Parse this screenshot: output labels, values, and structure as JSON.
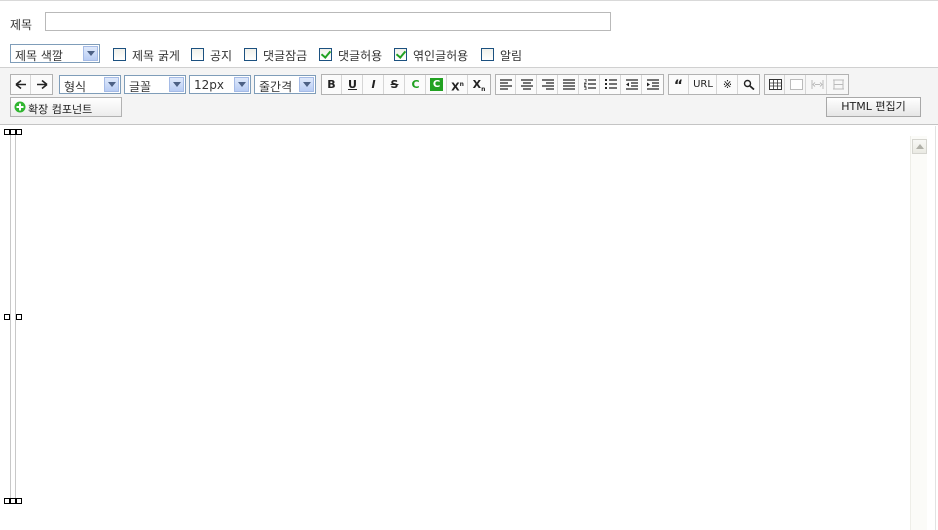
{
  "title_row": {
    "label": "제목",
    "value": ""
  },
  "options": {
    "title_color_select": "제목 색깔",
    "checkboxes": [
      {
        "label": "제목 굵게",
        "checked": false
      },
      {
        "label": "공지",
        "checked": false
      },
      {
        "label": "댓글잠금",
        "checked": false
      },
      {
        "label": "댓글허용",
        "checked": true
      },
      {
        "label": "엮인글허용",
        "checked": true
      },
      {
        "label": "알림",
        "checked": false
      }
    ]
  },
  "toolbar": {
    "format_select": "형식",
    "font_select": "글꼴",
    "size_select": "12px",
    "lineheight_select": "줄간격",
    "text_buttons": {
      "bold": "B",
      "underline": "U",
      "italic": "I",
      "strike": "S",
      "fcolor": "C",
      "bgcolor": "C",
      "sup": "X",
      "sub": "X",
      "quote": "“",
      "url": "URL",
      "special": "※"
    },
    "ext_component": "확장 컴포넌트",
    "html_editor": "HTML 편집기"
  },
  "colors": {
    "accent_green": "#21a121",
    "select_border": "#7f9db9"
  }
}
